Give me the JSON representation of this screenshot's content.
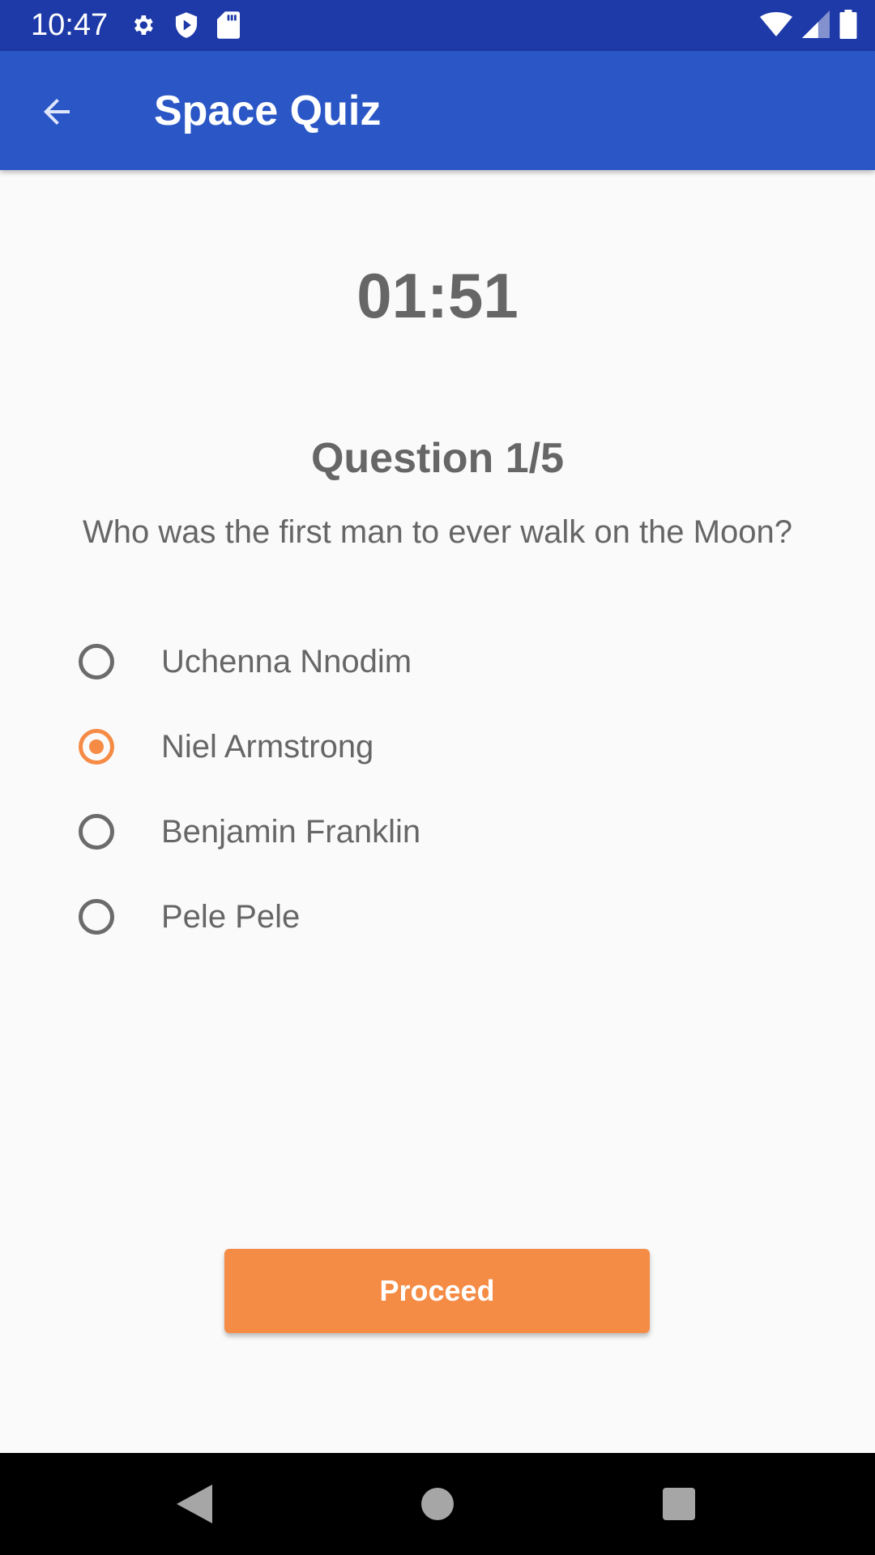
{
  "status_bar": {
    "time": "10:47",
    "left_icons": [
      "settings-icon",
      "shield-play-icon",
      "sd-card-icon"
    ],
    "right_icons": [
      "wifi-icon",
      "cell-signal-icon",
      "battery-icon"
    ]
  },
  "app_bar": {
    "title": "Space Quiz",
    "back_icon": "arrow-back-icon",
    "color": "#2b57c6"
  },
  "quiz": {
    "timer": "01:51",
    "question_number": "Question 1/5",
    "question_text": "Who was the first man to ever walk on the Moon?",
    "options": [
      {
        "label": "Uchenna Nnodim",
        "selected": false
      },
      {
        "label": "Niel Armstrong",
        "selected": true
      },
      {
        "label": "Benjamin Franklin",
        "selected": false
      },
      {
        "label": "Pele Pele",
        "selected": false
      }
    ],
    "proceed_label": "Proceed",
    "accent_color": "#f58c46"
  },
  "nav_bar": {
    "icons": [
      "back-triangle-icon",
      "home-circle-icon",
      "recents-square-icon"
    ]
  }
}
